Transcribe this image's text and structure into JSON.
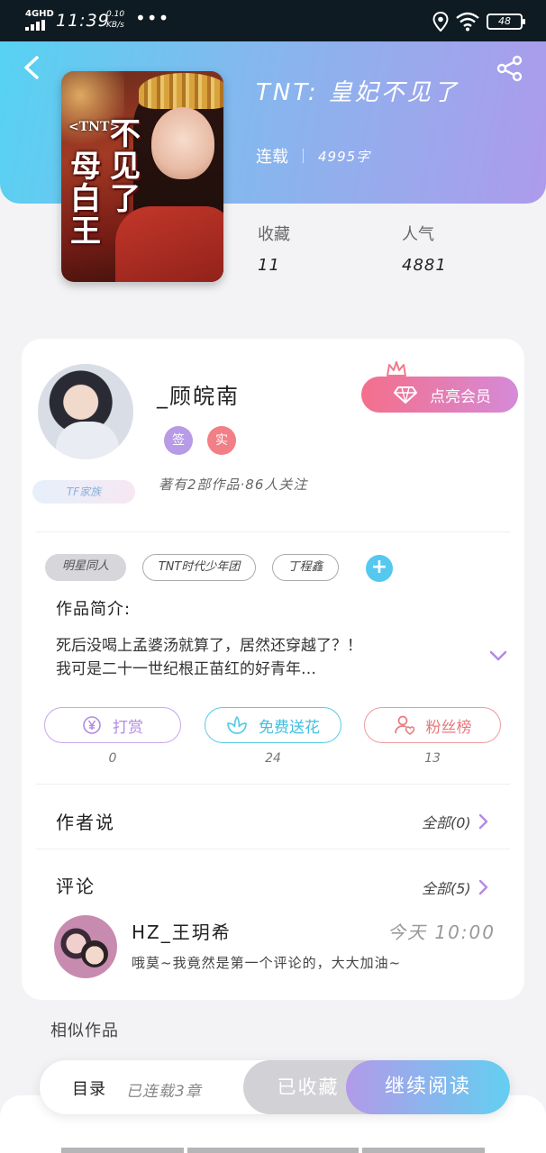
{
  "status_bar": {
    "network": "4GHD",
    "time": "11:39",
    "speed_value": "0.10",
    "speed_unit": "KB/s",
    "dots": "•••",
    "battery": "48"
  },
  "book": {
    "title": "TNT: 皇妃不见了",
    "status": "连载",
    "word_count": "4995字",
    "cover": {
      "brand": "<TNT>",
      "title_col1": "不见了",
      "title_col2": "母白王"
    },
    "stats": [
      {
        "label": "收藏",
        "value": "11"
      },
      {
        "label": "人气",
        "value": "4881"
      }
    ]
  },
  "author": {
    "name": "_顾皖南",
    "badges": [
      "签",
      "实"
    ],
    "fan_tag": "TF家族",
    "summary": "著有2部作品·86人关注",
    "vip_label": "点亮会员"
  },
  "tags": [
    "明星同人",
    "TNT时代少年团",
    "丁程鑫"
  ],
  "tag_add": "+",
  "intro": {
    "title": "作品简介:",
    "line1": "死后没喝上孟婆汤就算了，居然还穿越了？！",
    "line2": "我可是二十一世纪根正苗红的好青年…"
  },
  "actions": [
    {
      "label": "打赏",
      "count": "0",
      "color": "#b38ae2"
    },
    {
      "label": "免费送花",
      "count": "24",
      "color": "#57cbe6"
    },
    {
      "label": "粉丝榜",
      "count": "13",
      "color": "#ee8a8d"
    }
  ],
  "author_says": {
    "title": "作者说",
    "more": "全部(0)"
  },
  "comments": {
    "title": "评论",
    "more": "全部(5)",
    "items": [
      {
        "user": "HZ_王玥希",
        "time": "今天 10:00",
        "text": "哦莫~我竟然是第一个评论的，大大加油~"
      }
    ]
  },
  "similar": {
    "title": "相似作品"
  },
  "bottom_bar": {
    "toc": "目录",
    "chapters": "已连载3章",
    "favorited": "已收藏",
    "continue": "继续阅读"
  },
  "colors": {
    "header_start": "#55d3f2",
    "header_end": "#ad9beb",
    "accent_purple": "#b38ae2",
    "vip_pink": "#f46f8b"
  }
}
